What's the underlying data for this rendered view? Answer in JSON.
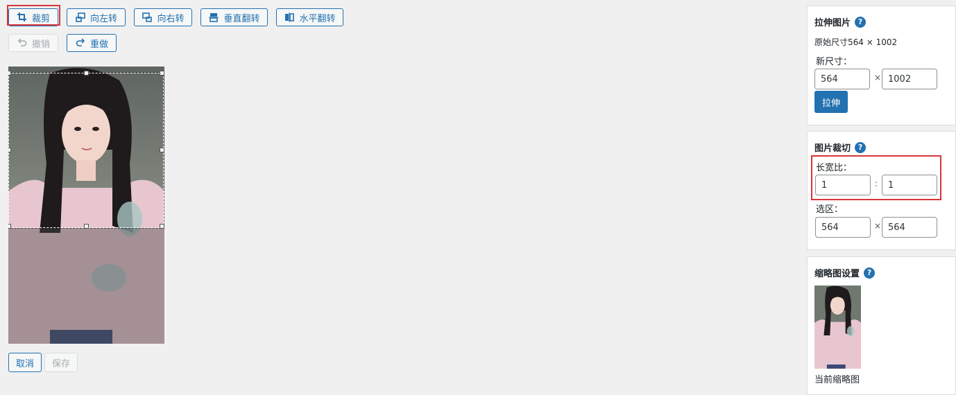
{
  "toolbar": {
    "crop": "裁剪",
    "rotate_left": "向左转",
    "rotate_right": "向右转",
    "flip_vertical": "垂直翻转",
    "flip_horizontal": "水平翻转",
    "undo": "撤销",
    "redo": "重做"
  },
  "actions": {
    "cancel": "取消",
    "save": "保存"
  },
  "scale": {
    "title": "拉伸图片",
    "help": "?",
    "original": "原始尺寸564 × 1002",
    "new_size_label": "新尺寸：",
    "width": "564",
    "height": "1002",
    "separator": "×",
    "button": "拉伸"
  },
  "crop_panel": {
    "title": "图片裁切",
    "help": "?",
    "ratio_label": "长宽比：",
    "ratio_w": "1",
    "ratio_h": "1",
    "ratio_sep": ":",
    "selection_label": "选区：",
    "sel_w": "564",
    "sel_h": "564",
    "sel_sep": "×"
  },
  "thumb": {
    "title": "缩略图设置",
    "help": "?",
    "caption": "当前缩略图"
  },
  "colors": {
    "accent": "#2271b1",
    "highlight": "#d63638"
  }
}
